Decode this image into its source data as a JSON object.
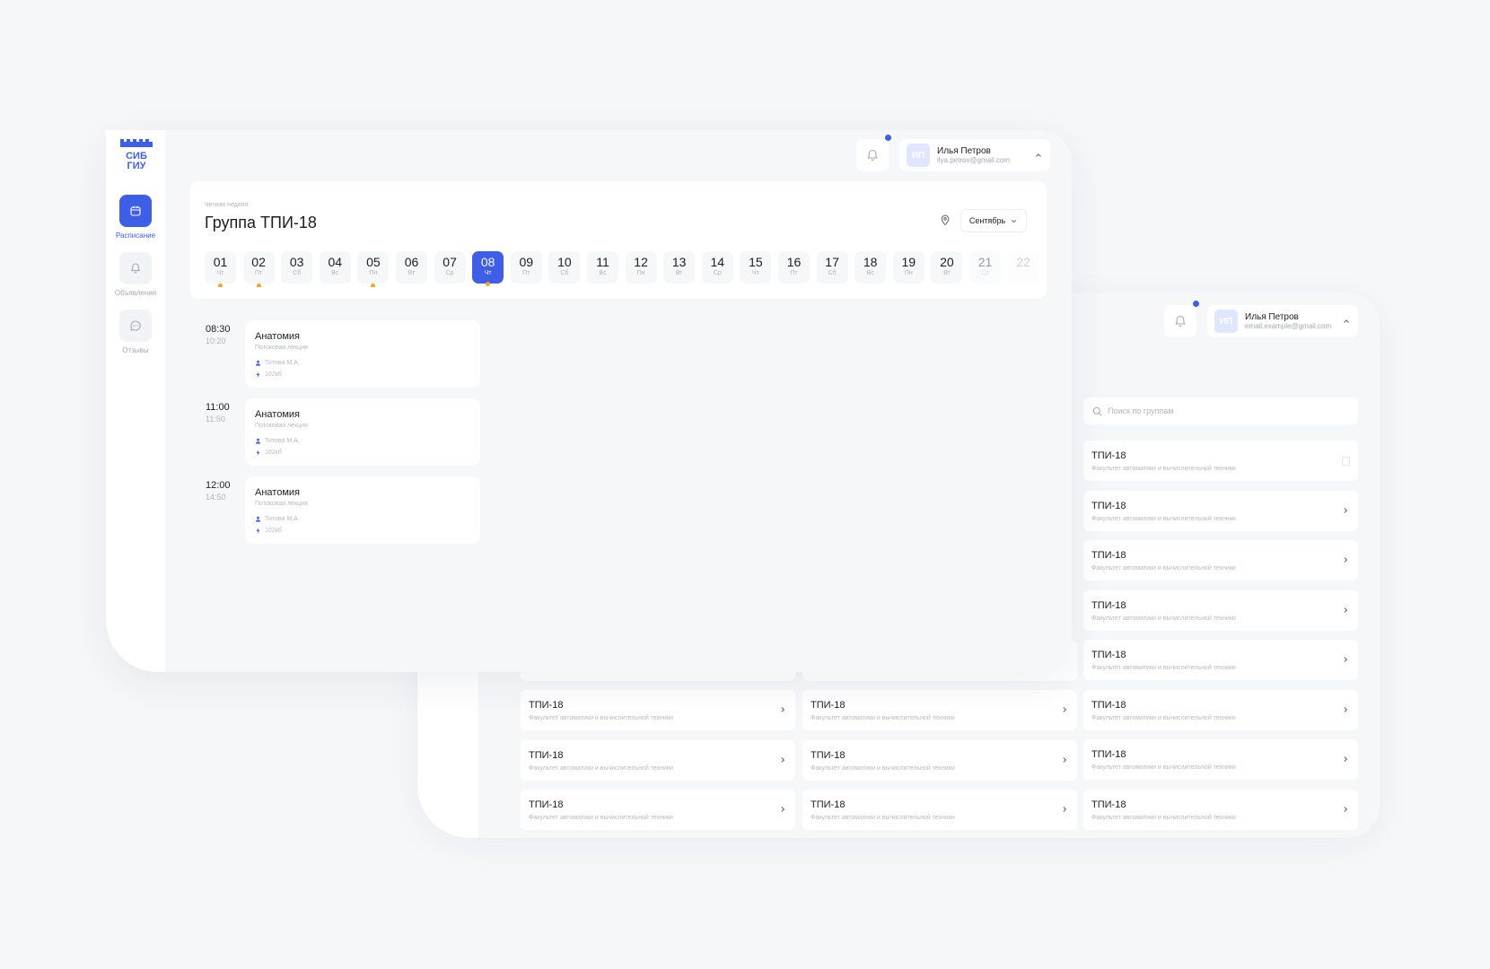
{
  "colors": {
    "accent": "#3f5ee8",
    "dot": "#f5a524",
    "muted": "#b0b3bc",
    "bg": "#f6f7f9"
  },
  "back": {
    "user": {
      "initials": "ИП",
      "name": "Илья Петров",
      "email": "email.example@gmail.com"
    },
    "search": {
      "placeholder": "Поиск по группам"
    },
    "groups": [
      {
        "title": "ТПИ-18",
        "subtitle": "Факультет автоматики и вычислительной техники"
      },
      {
        "title": "ТПИ-18",
        "subtitle": "Факультет автоматики и вычислительной техники"
      },
      {
        "title": "ТПИ-18",
        "subtitle": "Факультет автоматики и вычислительной техники"
      },
      {
        "title": "ТПИ-18",
        "subtitle": "Факультет автоматики и вычислительной техники"
      },
      {
        "title": "ТПИ-18",
        "subtitle": "Факультет автоматики и вычислительной техники"
      },
      {
        "title": "ТПИ-18",
        "subtitle": "Факультет автоматики и вычислительной техники"
      },
      {
        "title": "ТПИ-18",
        "subtitle": "Факультет автоматики и вычислительной техники"
      },
      {
        "title": "ТПИ-18",
        "subtitle": "Факультет автоматики и вычислительной техники"
      },
      {
        "title": "ТПИ-18",
        "subtitle": "Факультет автоматики и вычислительной техники"
      },
      {
        "title": "ТПИ-18",
        "subtitle": "Факультет автоматики и вычислительной техники"
      },
      {
        "title": "ТПИ-18",
        "subtitle": "Факультет автоматики и вычислительной техники"
      },
      {
        "title": "ТПИ-18",
        "subtitle": "Факультет автоматики и вычислительной техники"
      },
      {
        "title": "ТПИ-18",
        "subtitle": "Факультет автоматики и вычислительной техники"
      },
      {
        "title": "ТПИ-18",
        "subtitle": "Факультет автоматики и вычислительной техники"
      }
    ]
  },
  "front": {
    "logo": {
      "line1": "СИБ",
      "line2": "ГИУ"
    },
    "nav": [
      {
        "label": "Расписание",
        "icon": "calendar-icon",
        "active": true
      },
      {
        "label": "Объявления",
        "icon": "bell-icon",
        "active": false
      },
      {
        "label": "Отзывы",
        "icon": "chat-icon",
        "active": false
      }
    ],
    "user": {
      "initials": "ИП",
      "name": "Илья Петров",
      "email": "ilya.petrov@gmail.com"
    },
    "schedule": {
      "week_type": "Четная неделя",
      "title": "Группа ТПИ-18",
      "month": "Сентябрь",
      "days": [
        {
          "num": "01",
          "wd": "Чт",
          "dot": true
        },
        {
          "num": "02",
          "wd": "Пт",
          "dot": true
        },
        {
          "num": "03",
          "wd": "Сб",
          "dot": false
        },
        {
          "num": "04",
          "wd": "Вс",
          "dot": false
        },
        {
          "num": "05",
          "wd": "Пн",
          "dot": true
        },
        {
          "num": "06",
          "wd": "Вт",
          "dot": false
        },
        {
          "num": "07",
          "wd": "Ср",
          "dot": false
        },
        {
          "num": "08",
          "wd": "Чт",
          "dot": false,
          "active": true
        },
        {
          "num": "09",
          "wd": "Пт",
          "dot": false
        },
        {
          "num": "10",
          "wd": "Сб",
          "dot": false
        },
        {
          "num": "11",
          "wd": "Вс",
          "dot": false
        },
        {
          "num": "12",
          "wd": "Пн",
          "dot": false
        },
        {
          "num": "13",
          "wd": "Вт",
          "dot": false
        },
        {
          "num": "14",
          "wd": "Ср",
          "dot": false
        },
        {
          "num": "15",
          "wd": "Чт",
          "dot": false
        },
        {
          "num": "16",
          "wd": "Пт",
          "dot": false
        },
        {
          "num": "17",
          "wd": "Сб",
          "dot": false
        },
        {
          "num": "18",
          "wd": "Вс",
          "dot": false
        },
        {
          "num": "19",
          "wd": "Пн",
          "dot": false
        },
        {
          "num": "20",
          "wd": "Вт",
          "dot": false
        },
        {
          "num": "21",
          "wd": "Ср",
          "dot": false,
          "fade": 1
        },
        {
          "num": "22",
          "wd": "",
          "dot": false,
          "fade": 2
        }
      ],
      "lessons": [
        {
          "start": "08:30",
          "end": "10:20",
          "title": "Анатомия",
          "type": "Потоковая лекция",
          "teacher": "Титова М.А.",
          "room": "102кб"
        },
        {
          "start": "11:00",
          "end": "11:50",
          "title": "Анатомия",
          "type": "Потоковая лекция",
          "teacher": "Титова М.А.",
          "room": "102кб"
        },
        {
          "start": "12:00",
          "end": "14:50",
          "title": "Анатомия",
          "type": "Потоковая лекция",
          "teacher": "Титова М.А.",
          "room": "102кб"
        }
      ]
    }
  }
}
